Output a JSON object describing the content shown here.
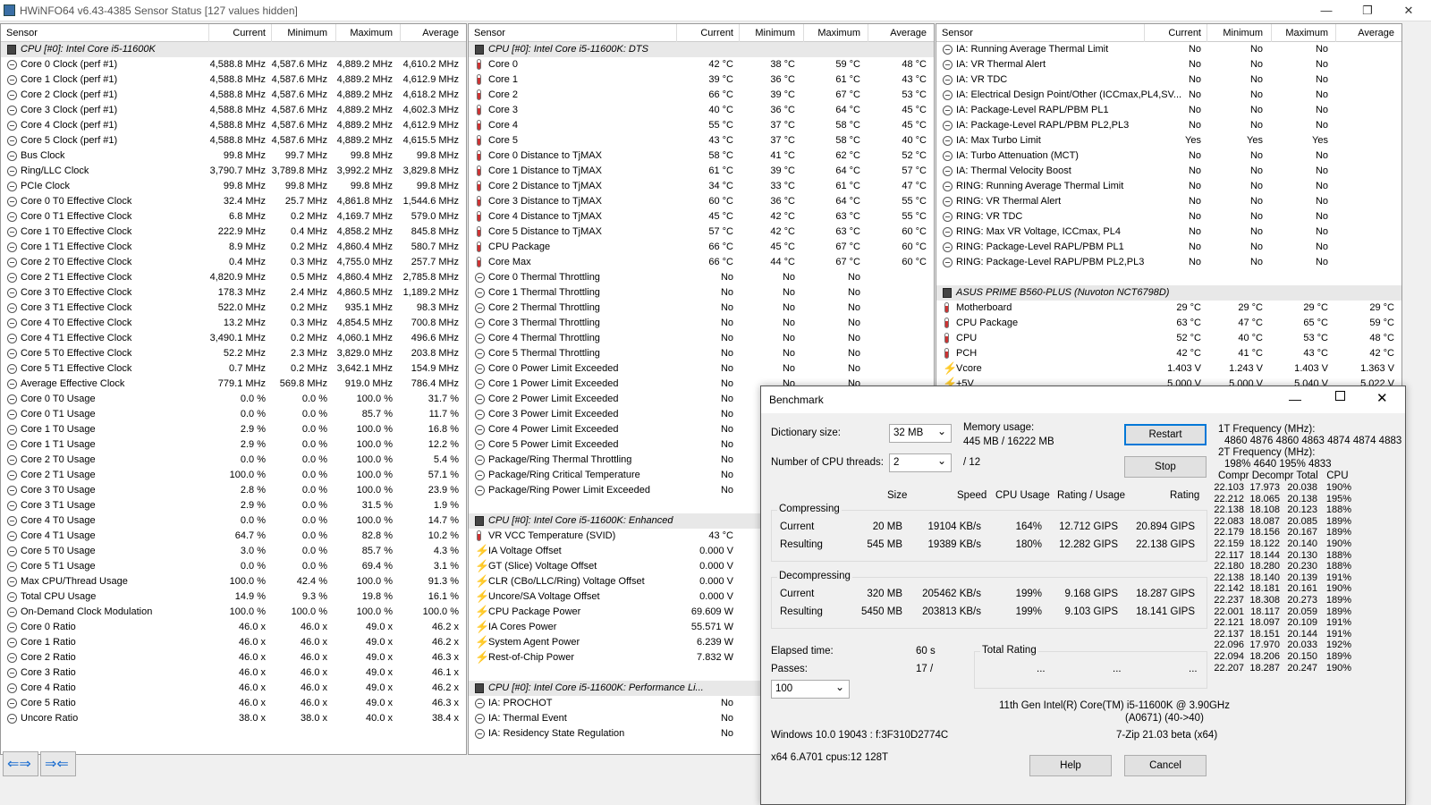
{
  "window": {
    "title": "HWiNFO64 v6.43-4385 Sensor Status [127 values hidden]"
  },
  "headers": [
    "Sensor",
    "Current",
    "Minimum",
    "Maximum",
    "Average"
  ],
  "col1": [
    [
      "g",
      "CPU [#0]: Intel Core i5-11600K",
      "",
      "",
      "",
      ""
    ],
    [
      "c",
      "Core 0 Clock (perf #1)",
      "4,588.8 MHz",
      "4,587.6 MHz",
      "4,889.2 MHz",
      "4,610.2 MHz"
    ],
    [
      "c",
      "Core 1 Clock (perf #1)",
      "4,588.8 MHz",
      "4,587.6 MHz",
      "4,889.2 MHz",
      "4,612.9 MHz"
    ],
    [
      "c",
      "Core 2 Clock (perf #1)",
      "4,588.8 MHz",
      "4,587.6 MHz",
      "4,889.2 MHz",
      "4,618.2 MHz"
    ],
    [
      "c",
      "Core 3 Clock (perf #1)",
      "4,588.8 MHz",
      "4,587.6 MHz",
      "4,889.2 MHz",
      "4,602.3 MHz"
    ],
    [
      "c",
      "Core 4 Clock (perf #1)",
      "4,588.8 MHz",
      "4,587.6 MHz",
      "4,889.2 MHz",
      "4,612.9 MHz"
    ],
    [
      "c",
      "Core 5 Clock (perf #1)",
      "4,588.8 MHz",
      "4,587.6 MHz",
      "4,889.2 MHz",
      "4,615.5 MHz"
    ],
    [
      "c",
      "Bus Clock",
      "99.8 MHz",
      "99.7 MHz",
      "99.8 MHz",
      "99.8 MHz"
    ],
    [
      "c",
      "Ring/LLC Clock",
      "3,790.7 MHz",
      "3,789.8 MHz",
      "3,992.2 MHz",
      "3,829.8 MHz"
    ],
    [
      "c",
      "PCIe Clock",
      "99.8 MHz",
      "99.8 MHz",
      "99.8 MHz",
      "99.8 MHz"
    ],
    [
      "c",
      "Core 0 T0 Effective Clock",
      "32.4 MHz",
      "25.7 MHz",
      "4,861.8 MHz",
      "1,544.6 MHz"
    ],
    [
      "c",
      "Core 0 T1 Effective Clock",
      "6.8 MHz",
      "0.2 MHz",
      "4,169.7 MHz",
      "579.0 MHz"
    ],
    [
      "c",
      "Core 1 T0 Effective Clock",
      "222.9 MHz",
      "0.4 MHz",
      "4,858.2 MHz",
      "845.8 MHz"
    ],
    [
      "c",
      "Core 1 T1 Effective Clock",
      "8.9 MHz",
      "0.2 MHz",
      "4,860.4 MHz",
      "580.7 MHz"
    ],
    [
      "c",
      "Core 2 T0 Effective Clock",
      "0.4 MHz",
      "0.3 MHz",
      "4,755.0 MHz",
      "257.7 MHz"
    ],
    [
      "c",
      "Core 2 T1 Effective Clock",
      "4,820.9 MHz",
      "0.5 MHz",
      "4,860.4 MHz",
      "2,785.8 MHz"
    ],
    [
      "c",
      "Core 3 T0 Effective Clock",
      "178.3 MHz",
      "2.4 MHz",
      "4,860.5 MHz",
      "1,189.2 MHz"
    ],
    [
      "c",
      "Core 3 T1 Effective Clock",
      "522.0 MHz",
      "0.2 MHz",
      "935.1 MHz",
      "98.3 MHz"
    ],
    [
      "c",
      "Core 4 T0 Effective Clock",
      "13.2 MHz",
      "0.3 MHz",
      "4,854.5 MHz",
      "700.8 MHz"
    ],
    [
      "c",
      "Core 4 T1 Effective Clock",
      "3,490.1 MHz",
      "0.2 MHz",
      "4,060.1 MHz",
      "496.6 MHz"
    ],
    [
      "c",
      "Core 5 T0 Effective Clock",
      "52.2 MHz",
      "2.3 MHz",
      "3,829.0 MHz",
      "203.8 MHz"
    ],
    [
      "c",
      "Core 5 T1 Effective Clock",
      "0.7 MHz",
      "0.2 MHz",
      "3,642.1 MHz",
      "154.9 MHz"
    ],
    [
      "c",
      "Average Effective Clock",
      "779.1 MHz",
      "569.8 MHz",
      "919.0 MHz",
      "786.4 MHz"
    ],
    [
      "c",
      "Core 0 T0 Usage",
      "0.0 %",
      "0.0 %",
      "100.0 %",
      "31.7 %"
    ],
    [
      "c",
      "Core 0 T1 Usage",
      "0.0 %",
      "0.0 %",
      "85.7 %",
      "11.7 %"
    ],
    [
      "c",
      "Core 1 T0 Usage",
      "2.9 %",
      "0.0 %",
      "100.0 %",
      "16.8 %"
    ],
    [
      "c",
      "Core 1 T1 Usage",
      "2.9 %",
      "0.0 %",
      "100.0 %",
      "12.2 %"
    ],
    [
      "c",
      "Core 2 T0 Usage",
      "0.0 %",
      "0.0 %",
      "100.0 %",
      "5.4 %"
    ],
    [
      "c",
      "Core 2 T1 Usage",
      "100.0 %",
      "0.0 %",
      "100.0 %",
      "57.1 %"
    ],
    [
      "c",
      "Core 3 T0 Usage",
      "2.8 %",
      "0.0 %",
      "100.0 %",
      "23.9 %"
    ],
    [
      "c",
      "Core 3 T1 Usage",
      "2.9 %",
      "0.0 %",
      "31.5 %",
      "1.9 %"
    ],
    [
      "c",
      "Core 4 T0 Usage",
      "0.0 %",
      "0.0 %",
      "100.0 %",
      "14.7 %"
    ],
    [
      "c",
      "Core 4 T1 Usage",
      "64.7 %",
      "0.0 %",
      "82.8 %",
      "10.2 %"
    ],
    [
      "c",
      "Core 5 T0 Usage",
      "3.0 %",
      "0.0 %",
      "85.7 %",
      "4.3 %"
    ],
    [
      "c",
      "Core 5 T1 Usage",
      "0.0 %",
      "0.0 %",
      "69.4 %",
      "3.1 %"
    ],
    [
      "c",
      "Max CPU/Thread Usage",
      "100.0 %",
      "42.4 %",
      "100.0 %",
      "91.3 %"
    ],
    [
      "c",
      "Total CPU Usage",
      "14.9 %",
      "9.3 %",
      "19.8 %",
      "16.1 %"
    ],
    [
      "c",
      "On-Demand Clock Modulation",
      "100.0 %",
      "100.0 %",
      "100.0 %",
      "100.0 %"
    ],
    [
      "c",
      "Core 0 Ratio",
      "46.0 x",
      "46.0 x",
      "49.0 x",
      "46.2 x"
    ],
    [
      "c",
      "Core 1 Ratio",
      "46.0 x",
      "46.0 x",
      "49.0 x",
      "46.2 x"
    ],
    [
      "c",
      "Core 2 Ratio",
      "46.0 x",
      "46.0 x",
      "49.0 x",
      "46.3 x"
    ],
    [
      "c",
      "Core 3 Ratio",
      "46.0 x",
      "46.0 x",
      "49.0 x",
      "46.1 x"
    ],
    [
      "c",
      "Core 4 Ratio",
      "46.0 x",
      "46.0 x",
      "49.0 x",
      "46.2 x"
    ],
    [
      "c",
      "Core 5 Ratio",
      "46.0 x",
      "46.0 x",
      "49.0 x",
      "46.3 x"
    ],
    [
      "c",
      "Uncore Ratio",
      "38.0 x",
      "38.0 x",
      "40.0 x",
      "38.4 x"
    ]
  ],
  "col2": [
    [
      "g",
      "CPU [#0]: Intel Core i5-11600K: DTS",
      "",
      "",
      "",
      ""
    ],
    [
      "t",
      "Core 0",
      "42 °C",
      "38 °C",
      "59 °C",
      "48 °C"
    ],
    [
      "t",
      "Core 1",
      "39 °C",
      "36 °C",
      "61 °C",
      "43 °C"
    ],
    [
      "t",
      "Core 2",
      "66 °C",
      "39 °C",
      "67 °C",
      "53 °C"
    ],
    [
      "t",
      "Core 3",
      "40 °C",
      "36 °C",
      "64 °C",
      "45 °C"
    ],
    [
      "t",
      "Core 4",
      "55 °C",
      "37 °C",
      "58 °C",
      "45 °C"
    ],
    [
      "t",
      "Core 5",
      "43 °C",
      "37 °C",
      "58 °C",
      "40 °C"
    ],
    [
      "t",
      "Core 0 Distance to TjMAX",
      "58 °C",
      "41 °C",
      "62 °C",
      "52 °C"
    ],
    [
      "t",
      "Core 1 Distance to TjMAX",
      "61 °C",
      "39 °C",
      "64 °C",
      "57 °C"
    ],
    [
      "t",
      "Core 2 Distance to TjMAX",
      "34 °C",
      "33 °C",
      "61 °C",
      "47 °C"
    ],
    [
      "t",
      "Core 3 Distance to TjMAX",
      "60 °C",
      "36 °C",
      "64 °C",
      "55 °C"
    ],
    [
      "t",
      "Core 4 Distance to TjMAX",
      "45 °C",
      "42 °C",
      "63 °C",
      "55 °C"
    ],
    [
      "t",
      "Core 5 Distance to TjMAX",
      "57 °C",
      "42 °C",
      "63 °C",
      "60 °C"
    ],
    [
      "t",
      "CPU Package",
      "66 °C",
      "45 °C",
      "67 °C",
      "60 °C"
    ],
    [
      "t",
      "Core Max",
      "66 °C",
      "44 °C",
      "67 °C",
      "60 °C"
    ],
    [
      "c",
      "Core 0 Thermal Throttling",
      "No",
      "No",
      "No",
      ""
    ],
    [
      "c",
      "Core 1 Thermal Throttling",
      "No",
      "No",
      "No",
      ""
    ],
    [
      "c",
      "Core 2 Thermal Throttling",
      "No",
      "No",
      "No",
      ""
    ],
    [
      "c",
      "Core 3 Thermal Throttling",
      "No",
      "No",
      "No",
      ""
    ],
    [
      "c",
      "Core 4 Thermal Throttling",
      "No",
      "No",
      "No",
      ""
    ],
    [
      "c",
      "Core 5 Thermal Throttling",
      "No",
      "No",
      "No",
      ""
    ],
    [
      "c",
      "Core 0 Power Limit Exceeded",
      "No",
      "No",
      "No",
      ""
    ],
    [
      "c",
      "Core 1 Power Limit Exceeded",
      "No",
      "No",
      "No",
      ""
    ],
    [
      "c",
      "Core 2 Power Limit Exceeded",
      "No",
      "",
      "",
      " "
    ],
    [
      "c",
      "Core 3 Power Limit Exceeded",
      "No",
      "",
      "",
      ""
    ],
    [
      "c",
      "Core 4 Power Limit Exceeded",
      "No",
      "",
      "",
      ""
    ],
    [
      "c",
      "Core 5 Power Limit Exceeded",
      "No",
      "",
      "",
      ""
    ],
    [
      "c",
      "Package/Ring Thermal Throttling",
      "No",
      "",
      "",
      ""
    ],
    [
      "c",
      "Package/Ring Critical Temperature",
      "No",
      "",
      "",
      ""
    ],
    [
      "c",
      "Package/Ring Power Limit Exceeded",
      "No",
      "",
      "",
      ""
    ],
    [
      "e",
      "",
      "",
      "",
      "",
      ""
    ],
    [
      "g",
      "CPU [#0]: Intel Core i5-11600K: Enhanced",
      "",
      "",
      "",
      ""
    ],
    [
      "t",
      "VR VCC Temperature (SVID)",
      "43 °C",
      "",
      "",
      ""
    ],
    [
      "b",
      "IA Voltage Offset",
      "0.000 V",
      "",
      "",
      ""
    ],
    [
      "b",
      "GT (Slice) Voltage Offset",
      "0.000 V",
      "",
      "",
      ""
    ],
    [
      "b",
      "CLR (CBo/LLC/Ring) Voltage Offset",
      "0.000 V",
      "",
      "",
      ""
    ],
    [
      "b",
      "Uncore/SA Voltage Offset",
      "0.000 V",
      "",
      "",
      ""
    ],
    [
      "b",
      "CPU Package Power",
      "69.609 W",
      "",
      "",
      ""
    ],
    [
      "b",
      "IA Cores Power",
      "55.571 W",
      "",
      "",
      ""
    ],
    [
      "b",
      "System Agent Power",
      "6.239 W",
      "",
      "",
      ""
    ],
    [
      "b",
      "Rest-of-Chip Power",
      "7.832 W",
      "",
      "",
      ""
    ],
    [
      "e",
      "",
      "",
      "",
      "",
      ""
    ],
    [
      "g",
      "CPU [#0]: Intel Core i5-11600K: Performance Li...",
      "",
      "",
      "",
      ""
    ],
    [
      "c",
      "IA: PROCHOT",
      "No",
      "",
      "",
      ""
    ],
    [
      "c",
      "IA: Thermal Event",
      "No",
      "",
      "",
      ""
    ],
    [
      "c",
      "IA: Residency State Regulation",
      "No",
      "",
      "",
      ""
    ]
  ],
  "col3": [
    [
      "c",
      "IA: Running Average Thermal Limit",
      "No",
      "No",
      "No",
      ""
    ],
    [
      "c",
      "IA: VR Thermal Alert",
      "No",
      "No",
      "No",
      ""
    ],
    [
      "c",
      "IA: VR TDC",
      "No",
      "No",
      "No",
      ""
    ],
    [
      "c",
      "IA: Electrical Design Point/Other (ICCmax,PL4,SV...",
      "No",
      "No",
      "No",
      ""
    ],
    [
      "c",
      "IA: Package-Level RAPL/PBM PL1",
      "No",
      "No",
      "No",
      ""
    ],
    [
      "c",
      "IA: Package-Level RAPL/PBM PL2,PL3",
      "No",
      "No",
      "No",
      ""
    ],
    [
      "c",
      "IA: Max Turbo Limit",
      "Yes",
      "Yes",
      "Yes",
      ""
    ],
    [
      "c",
      "IA: Turbo Attenuation (MCT)",
      "No",
      "No",
      "No",
      ""
    ],
    [
      "c",
      "IA: Thermal Velocity Boost",
      "No",
      "No",
      "No",
      ""
    ],
    [
      "c",
      "RING: Running Average Thermal Limit",
      "No",
      "No",
      "No",
      ""
    ],
    [
      "c",
      "RING: VR Thermal Alert",
      "No",
      "No",
      "No",
      ""
    ],
    [
      "c",
      "RING: VR TDC",
      "No",
      "No",
      "No",
      ""
    ],
    [
      "c",
      "RING: Max VR Voltage, ICCmax, PL4",
      "No",
      "No",
      "No",
      ""
    ],
    [
      "c",
      "RING: Package-Level RAPL/PBM PL1",
      "No",
      "No",
      "No",
      ""
    ],
    [
      "c",
      "RING: Package-Level RAPL/PBM PL2,PL3",
      "No",
      "No",
      "No",
      ""
    ],
    [
      "e",
      "",
      "",
      "",
      "",
      ""
    ],
    [
      "g",
      "ASUS PRIME B560-PLUS (Nuvoton NCT6798D)",
      "",
      "",
      "",
      ""
    ],
    [
      "t",
      "Motherboard",
      "29 °C",
      "29 °C",
      "29 °C",
      "29 °C"
    ],
    [
      "t",
      "CPU Package",
      "63 °C",
      "47 °C",
      "65 °C",
      "59 °C"
    ],
    [
      "t",
      "CPU",
      "52 °C",
      "40 °C",
      "53 °C",
      "48 °C"
    ],
    [
      "t",
      "PCH",
      "42 °C",
      "41 °C",
      "43 °C",
      "42 °C"
    ],
    [
      "b",
      "Vcore",
      "1.403 V",
      "1.243 V",
      "1.403 V",
      "1.363 V"
    ],
    [
      "b",
      "+5V",
      "5.000 V",
      "5.000 V",
      "5.040 V",
      "5.022 V"
    ]
  ],
  "bench": {
    "title": "Benchmark",
    "dict_label": "Dictionary size:",
    "dict_value": "32 MB",
    "mem_label": "Memory usage:",
    "mem_value": "445 MB / 16222 MB",
    "threads_label": "Number of CPU threads:",
    "threads_value": "2",
    "threads_total": "/ 12",
    "restart": "Restart",
    "stop": "Stop",
    "col_size": "Size",
    "col_speed": "Speed",
    "col_cpu": "CPU Usage",
    "col_ru": "Rating / Usage",
    "col_rating": "Rating",
    "comp": "Compressing",
    "decomp": "Decompressing",
    "rows": [
      [
        "Current",
        "20 MB",
        "19104 KB/s",
        "164%",
        "12.712 GIPS",
        "20.894 GIPS"
      ],
      [
        "Resulting",
        "545 MB",
        "19389 KB/s",
        "180%",
        "12.282 GIPS",
        "22.138 GIPS"
      ],
      [
        "Current",
        "320 MB",
        "205462 KB/s",
        "199%",
        "9.168 GIPS",
        "18.287 GIPS"
      ],
      [
        "Resulting",
        "5450 MB",
        "203813 KB/s",
        "199%",
        "9.103 GIPS",
        "18.141 GIPS"
      ]
    ],
    "elapsed_label": "Elapsed time:",
    "elapsed_value": "60 s",
    "passes_label": "Passes:",
    "passes_value": "17 /",
    "passes_select": "100",
    "total_rating": "Total Rating",
    "dots1": "...",
    "dots2": "...",
    "dots3": "...",
    "cpu_name": "11th Gen Intel(R) Core(TM) i5-11600K @ 3.90GHz",
    "cpu_id": "(A0671) (40->40)",
    "windows": "Windows 10.0 19043 : f:3F310D2774C",
    "zip": "7-Zip 21.03 beta (x64)",
    "arch": "x64 6.A701 cpus:12 128T",
    "help": "Help",
    "cancel": "Cancel",
    "f1_label": "1T Frequency (MHz):",
    "f1_values": "4860 4876 4860 4863 4874 4874 4883",
    "f2_label": "2T Frequency (MHz):",
    "f2_values": "198% 4640 195% 4833",
    "table_header": "Compr Decompr Total   CPU",
    "table": [
      [
        "22.103",
        "17.973",
        "20.038",
        "190%"
      ],
      [
        "22.212",
        "18.065",
        "20.138",
        "195%"
      ],
      [
        "22.138",
        "18.108",
        "20.123",
        "188%"
      ],
      [
        "22.083",
        "18.087",
        "20.085",
        "189%"
      ],
      [
        "22.179",
        "18.156",
        "20.167",
        "189%"
      ],
      [
        "22.159",
        "18.122",
        "20.140",
        "190%"
      ],
      [
        "22.117",
        "18.144",
        "20.130",
        "188%"
      ],
      [
        "22.180",
        "18.280",
        "20.230",
        "188%"
      ],
      [
        "22.138",
        "18.140",
        "20.139",
        "191%"
      ],
      [
        "22.142",
        "18.181",
        "20.161",
        "190%"
      ],
      [
        "22.237",
        "18.308",
        "20.273",
        "189%"
      ],
      [
        "22.001",
        "18.117",
        "20.059",
        "189%"
      ],
      [
        "22.121",
        "18.097",
        "20.109",
        "191%"
      ],
      [
        "22.137",
        "18.151",
        "20.144",
        "191%"
      ],
      [
        "22.096",
        "17.970",
        "20.033",
        "192%"
      ],
      [
        "22.094",
        "18.206",
        "20.150",
        "189%"
      ],
      [
        "22.207",
        "18.287",
        "20.247",
        "190%"
      ]
    ]
  }
}
